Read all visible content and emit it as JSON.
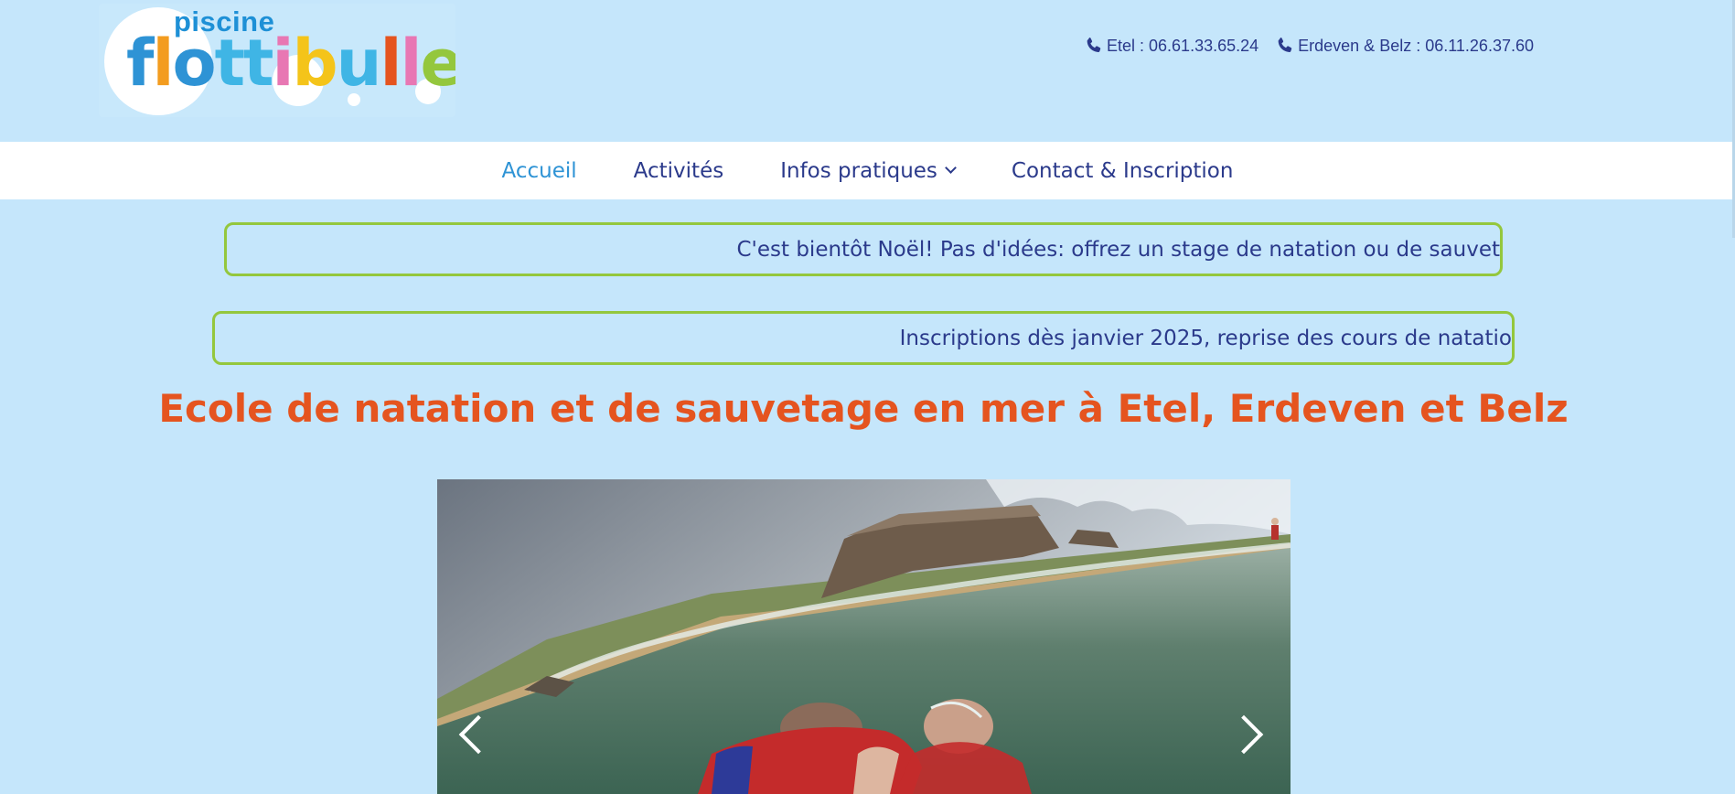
{
  "header": {
    "logo": {
      "small_word": "piscine",
      "letters": [
        {
          "ch": "f",
          "color": "#2e93d5"
        },
        {
          "ch": "l",
          "color": "#f39c1f"
        },
        {
          "ch": "o",
          "color": "#2e93d5"
        },
        {
          "ch": "t",
          "color": "#3fb5e5"
        },
        {
          "ch": "t",
          "color": "#3fb5e5"
        },
        {
          "ch": "i",
          "color": "#e877b3"
        },
        {
          "ch": "b",
          "color": "#f4c41a"
        },
        {
          "ch": "u",
          "color": "#3fb5e5"
        },
        {
          "ch": "l",
          "color": "#e5541f"
        },
        {
          "ch": "l",
          "color": "#e877b3"
        },
        {
          "ch": "e",
          "color": "#94c73d"
        }
      ]
    },
    "contacts": [
      {
        "icon": "phone-icon",
        "text": "Etel : 06.61.33.65.24"
      },
      {
        "icon": "phone-icon",
        "text": "Erdeven & Belz : 06.11.26.37.60"
      }
    ]
  },
  "nav": {
    "items": [
      {
        "label": "Accueil",
        "active": true
      },
      {
        "label": "Activités"
      },
      {
        "label": "Infos pratiques",
        "dropdown": true
      },
      {
        "label": "Contact & Inscription"
      }
    ]
  },
  "tickers": [
    "C'est bientôt Noël! Pas d'idées: offrez un stage de natation ou de sauvet",
    "Inscriptions dès janvier 2025, reprise des cours de natatio"
  ],
  "title": "Ecole de natation et de sauvetage en mer à Etel, Erdeven et Belz",
  "slider": {
    "prev_icon": "chevron-left-icon",
    "next_icon": "chevron-right-icon"
  },
  "colors": {
    "background": "#c5e6fb",
    "nav_text": "#2b3a8b",
    "nav_active": "#2e93d5",
    "title": "#e5541f",
    "ticker_border": "#94c73d"
  }
}
